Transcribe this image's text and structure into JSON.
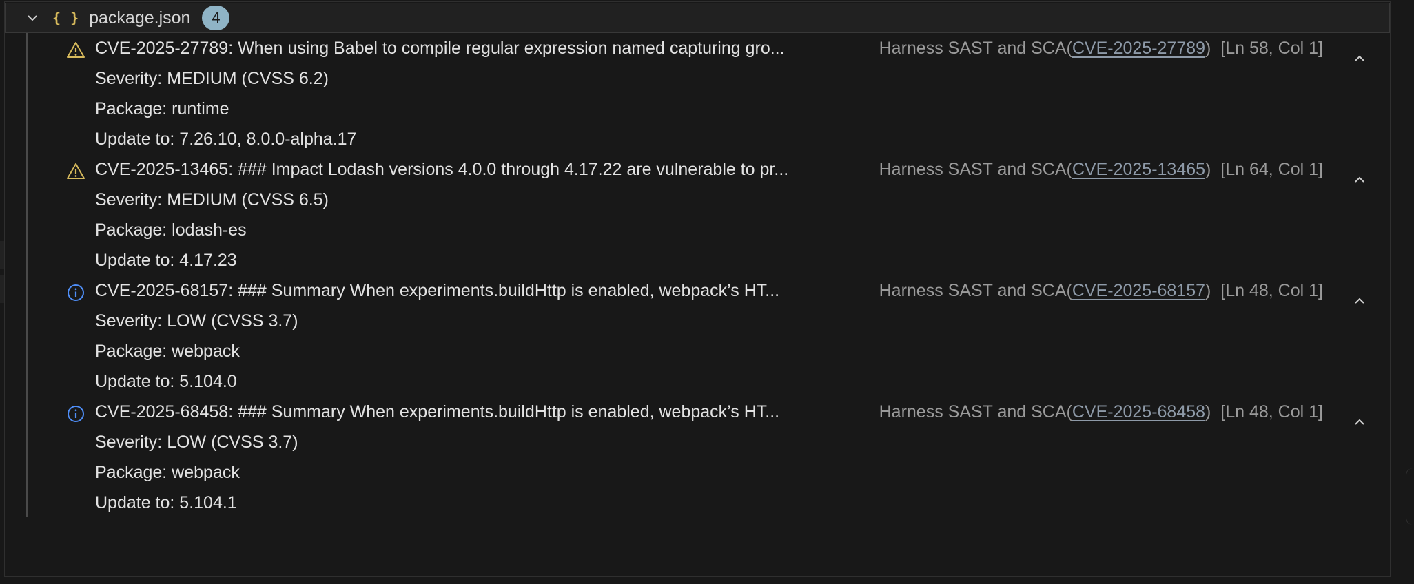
{
  "header": {
    "filename": "package.json",
    "count": "4",
    "file_icon_glyph": "{ }"
  },
  "problems": [
    {
      "severity_icon": "warning-icon",
      "message": "CVE-2025-27789: When using Babel to compile regular expression named capturing gro...",
      "source": "Harness SAST and SCA(",
      "code": "CVE-2025-27789",
      "source_close": ")",
      "location": "[Ln 58, Col 1]",
      "details": [
        "Severity: MEDIUM (CVSS 6.2)",
        "Package: runtime",
        "Update to: 7.26.10, 8.0.0-alpha.17"
      ]
    },
    {
      "severity_icon": "warning-icon",
      "message": "CVE-2025-13465: ### Impact Lodash versions 4.0.0 through 4.17.22 are vulnerable to pr...",
      "source": "Harness SAST and SCA(",
      "code": "CVE-2025-13465",
      "source_close": ")",
      "location": "[Ln 64, Col 1]",
      "details": [
        "Severity: MEDIUM (CVSS 6.5)",
        "Package: lodash-es",
        "Update to: 4.17.23"
      ]
    },
    {
      "severity_icon": "info-icon",
      "message": "CVE-2025-68157: ### Summary When experiments.buildHttp is enabled, webpack’s HT...",
      "source": "Harness SAST and SCA(",
      "code": "CVE-2025-68157",
      "source_close": ")",
      "location": "[Ln 48, Col 1]",
      "details": [
        "Severity: LOW (CVSS 3.7)",
        "Package: webpack",
        "Update to: 5.104.0"
      ]
    },
    {
      "severity_icon": "info-icon",
      "message": "CVE-2025-68458: ### Summary When experiments.buildHttp is enabled, webpack’s HT...",
      "source": "Harness SAST and SCA(",
      "code": "CVE-2025-68458",
      "source_close": ")",
      "location": "[Ln 48, Col 1]",
      "details": [
        "Severity: LOW (CVSS 3.7)",
        "Package: webpack",
        "Update to: 5.104.1"
      ]
    }
  ],
  "colors": {
    "warning": "#d7ba5c",
    "info": "#4f8ef7",
    "link": "#8e9aa8"
  }
}
